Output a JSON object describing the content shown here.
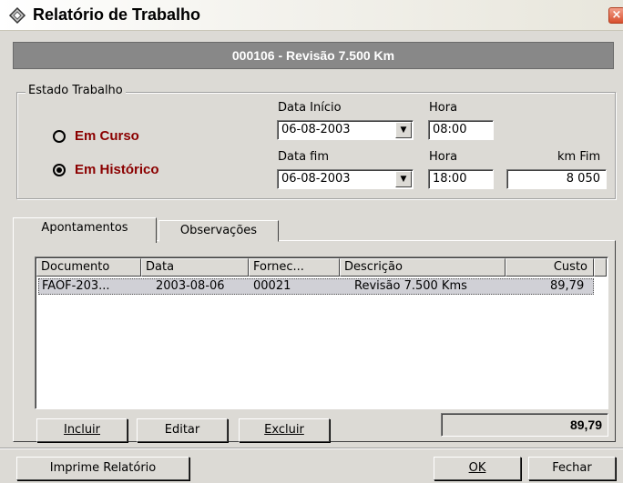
{
  "window": {
    "title": "Relatório de Trabalho",
    "icon": "wrench-icon",
    "close_label": "×"
  },
  "header": {
    "text": "000106 - Revisão 7.500 Km"
  },
  "estado": {
    "legend": "Estado Trabalho",
    "em_curso": "Em Curso",
    "em_historico": "Em Histórico",
    "selected": "Em Histórico"
  },
  "datas": {
    "data_inicio_label": "Data Início",
    "data_inicio": "06-08-2003",
    "hora_inicio_label": "Hora",
    "hora_inicio": "08:00",
    "data_fim_label": "Data fim",
    "data_fim": "06-08-2003",
    "hora_fim_label": "Hora",
    "hora_fim": "18:00",
    "km_fim_label": "km Fim",
    "km_fim": "8 050"
  },
  "tabs": [
    {
      "label": "Apontamentos",
      "active": true
    },
    {
      "label": "Observações",
      "active": false
    }
  ],
  "table": {
    "columns": [
      "Documento",
      "Data",
      "Fornec...",
      "Descrição",
      "Custo"
    ],
    "rows": [
      [
        "FAOF-203...",
        "2003-08-06",
        "00021",
        "Revisão 7.500 Kms",
        "89,79"
      ]
    ]
  },
  "actions": {
    "incluir": "Incluir",
    "editar": "Editar",
    "excluir": "Excluir",
    "total": "89,79"
  },
  "footer": {
    "imprime": "Imprime Relatório",
    "ok": "OK",
    "fechar": "Fechar"
  },
  "colors": {
    "radio_label": "#8b0000",
    "header_bar": "#888888",
    "dialog_bg": "#dcdad5",
    "selected_row": "#d0d0d6"
  }
}
